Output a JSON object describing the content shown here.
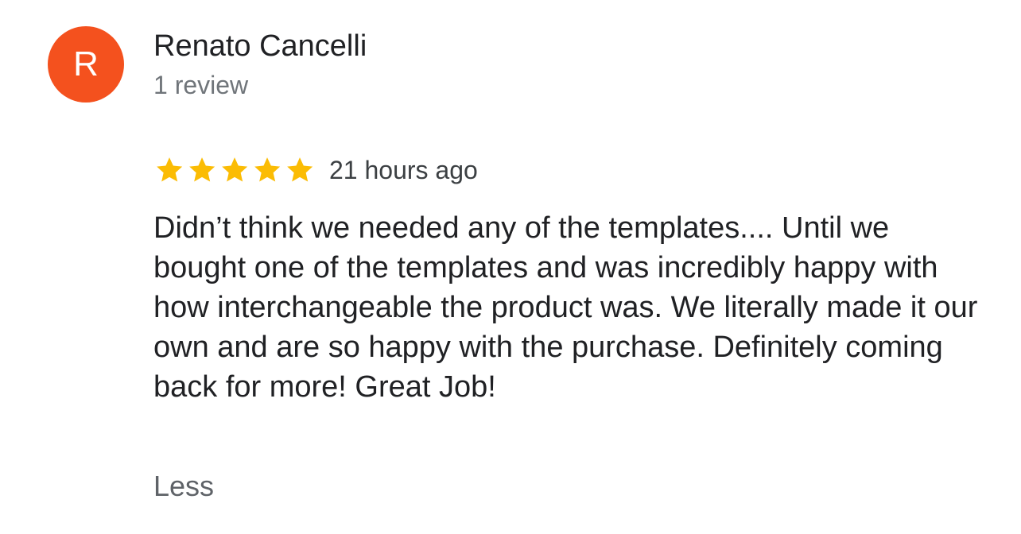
{
  "reviewer": {
    "initial": "R",
    "avatar_color": "#f4511e",
    "name": "Renato Cancelli",
    "review_count": "1 review"
  },
  "review": {
    "rating": 5,
    "rating_max": 5,
    "star_color": "#fbbc04",
    "star_icon": "star-icon",
    "timestamp": "21 hours ago",
    "text": "Didn’t think we needed any of the templates.... Until we bought one of the templates and was incredibly happy with how interchangeable the product was. We literally made it our own and are so happy with the purchase. Definitely coming back for more! Great Job!",
    "less_label": "Less"
  }
}
